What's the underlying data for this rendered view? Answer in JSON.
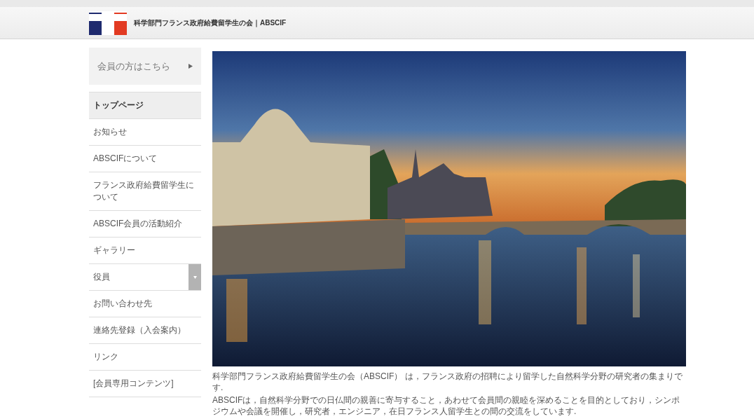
{
  "header": {
    "title": "科学部門フランス政府給費留学生の会｜ABSCIF"
  },
  "member_button": {
    "label": "会員の方はこちら"
  },
  "nav": [
    {
      "label": "トップページ",
      "selected": true,
      "kind": "link"
    },
    {
      "label": "お知らせ",
      "selected": false,
      "kind": "link"
    },
    {
      "label": "ABSCIFについて",
      "selected": false,
      "kind": "link"
    },
    {
      "label": "フランス政府給費留学生について",
      "selected": false,
      "kind": "link"
    },
    {
      "label": "ABSCIF会員の活動紹介",
      "selected": false,
      "kind": "link"
    },
    {
      "label": "ギャラリー",
      "selected": false,
      "kind": "link"
    },
    {
      "label": "役員",
      "selected": false,
      "kind": "dropdown"
    },
    {
      "label": "お問い合わせ先",
      "selected": false,
      "kind": "link"
    },
    {
      "label": "連絡先登録（入会案内）",
      "selected": false,
      "kind": "link"
    },
    {
      "label": "リンク",
      "selected": false,
      "kind": "link"
    },
    {
      "label": "[会員専用コンテンツ]",
      "selected": false,
      "kind": "link"
    }
  ],
  "intro": [
    "科学部門フランス政府給費留学生の会（ABSCIF） は，フランス政府の招聘により留学した自然科学分野の研究者の集まりです.",
    "ABSCIFは，自然科学分野での日仏間の親善に寄与すること，あわせて会員間の親睦を深めることを目的としており，シンポジウムや会議を開催し，研究者，エンジニア，在日フランス人留学生との間の交流をしています."
  ]
}
